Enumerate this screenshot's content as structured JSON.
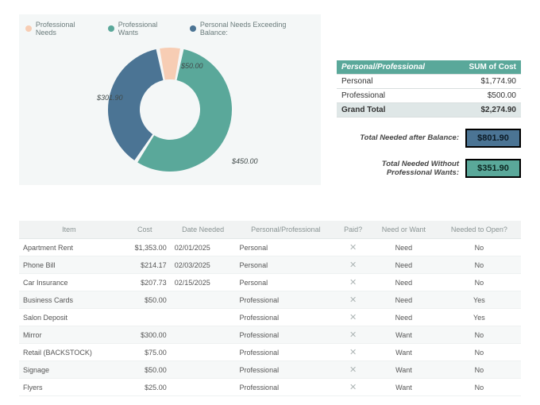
{
  "chart_data": {
    "type": "pie",
    "title": "",
    "series": [
      {
        "name": "Professional Needs",
        "value": 50.0,
        "label": "$50.00",
        "color": "#f7cdb4"
      },
      {
        "name": "Professional Wants",
        "value": 450.0,
        "label": "$450.00",
        "color": "#5aa89a"
      },
      {
        "name": "Personal Needs Exceeding Balance:",
        "value": 301.9,
        "label": "$301.90",
        "color": "#4b7494"
      }
    ]
  },
  "legend": {
    "items": [
      {
        "label": "Professional Needs",
        "color": "#f7cdb4"
      },
      {
        "label": "Professional Wants",
        "color": "#5aa89a"
      },
      {
        "label": "Personal Needs Exceeding Balance:",
        "color": "#4b7494"
      }
    ]
  },
  "summary": {
    "header_left": "Personal/Professional",
    "header_right": "SUM of Cost",
    "rows": [
      {
        "label": "Personal",
        "value": "$1,774.90"
      },
      {
        "label": "Professional",
        "value": "$500.00"
      }
    ],
    "grand_label": "Grand Total",
    "grand_value": "$2,274.90"
  },
  "totals": {
    "after_balance_label": "Total Needed after Balance:",
    "after_balance_value": "$801.90",
    "without_wants_label": "Total Needed Without Professional Wants:",
    "without_wants_value": "$351.90"
  },
  "table": {
    "headers": [
      "Item",
      "Cost",
      "Date Needed",
      "Personal/Professional",
      "Paid?",
      "Need or Want",
      "Needed to Open?"
    ],
    "rows": [
      {
        "item": "Apartment Rent",
        "cost": "$1,353.00",
        "date": "02/01/2025",
        "pp": "Personal",
        "paid": "x",
        "nw": "Need",
        "nto": "No"
      },
      {
        "item": "Phone Bill",
        "cost": "$214.17",
        "date": "02/03/2025",
        "pp": "Personal",
        "paid": "x",
        "nw": "Need",
        "nto": "No"
      },
      {
        "item": "Car Insurance",
        "cost": "$207.73",
        "date": "02/15/2025",
        "pp": "Personal",
        "paid": "x",
        "nw": "Need",
        "nto": "No"
      },
      {
        "item": "Business Cards",
        "cost": "$50.00",
        "date": "",
        "pp": "Professional",
        "paid": "x",
        "nw": "Need",
        "nto": "Yes"
      },
      {
        "item": "Salon Deposit",
        "cost": "",
        "date": "",
        "pp": "Professional",
        "paid": "x",
        "nw": "Need",
        "nto": "Yes"
      },
      {
        "item": "Mirror",
        "cost": "$300.00",
        "date": "",
        "pp": "Professional",
        "paid": "x",
        "nw": "Want",
        "nto": "No"
      },
      {
        "item": "Retail (BACKSTOCK)",
        "cost": "$75.00",
        "date": "",
        "pp": "Professional",
        "paid": "x",
        "nw": "Want",
        "nto": "No"
      },
      {
        "item": "Signage",
        "cost": "$50.00",
        "date": "",
        "pp": "Professional",
        "paid": "x",
        "nw": "Want",
        "nto": "No"
      },
      {
        "item": "Flyers",
        "cost": "$25.00",
        "date": "",
        "pp": "Professional",
        "paid": "x",
        "nw": "Want",
        "nto": "No"
      }
    ]
  }
}
